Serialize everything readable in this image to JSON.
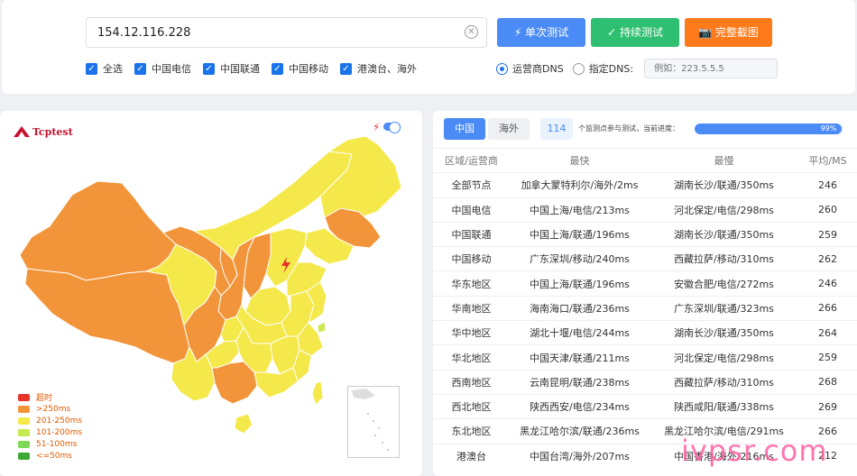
{
  "search": {
    "value": "154.12.116.228"
  },
  "buttons": {
    "single": "单次测试",
    "continuous": "持续测试",
    "screenshot": "完整截图"
  },
  "filters": [
    {
      "label": "全选",
      "checked": true
    },
    {
      "label": "中国电信",
      "checked": true
    },
    {
      "label": "中国联通",
      "checked": true
    },
    {
      "label": "中国移动",
      "checked": true
    },
    {
      "label": "港澳台、海外",
      "checked": true
    }
  ],
  "dns": {
    "isp_label": "运营商DNS",
    "custom_label": "指定DNS:",
    "placeholder": "例如：223.5.5.5",
    "selected": "isp"
  },
  "map": {
    "logo": "Tcptest",
    "legend": [
      {
        "label": "超时",
        "color": "#e5342a"
      },
      {
        "label": ">250ms",
        "color": "#f2953a"
      },
      {
        "label": "201-250ms",
        "color": "#f5e84a"
      },
      {
        "label": "101-200ms",
        "color": "#c7e94f"
      },
      {
        "label": "51-100ms",
        "color": "#7ed957"
      },
      {
        "label": "<=50ms",
        "color": "#3aa832"
      }
    ]
  },
  "results": {
    "tabs": [
      "中国",
      "海外"
    ],
    "active_tab": "中国",
    "count": "114",
    "count_label": "个监测点参与测试，当前进度：",
    "progress": 99,
    "progress_label": "99%",
    "headers": {
      "region": "区域/运营商",
      "fastest": "最快",
      "slowest": "最慢",
      "avg": "平均/MS"
    },
    "rows": [
      {
        "region": "全部节点",
        "fastest": "加拿大蒙特利尔/海外/2ms",
        "slowest": "湖南长沙/联通/350ms",
        "avg": "246"
      },
      {
        "region": "中国电信",
        "fastest": "中国上海/电信/213ms",
        "slowest": "河北保定/电信/298ms",
        "avg": "260"
      },
      {
        "region": "中国联通",
        "fastest": "中国上海/联通/196ms",
        "slowest": "湖南长沙/联通/350ms",
        "avg": "259"
      },
      {
        "region": "中国移动",
        "fastest": "广东深圳/移动/240ms",
        "slowest": "西藏拉萨/移动/310ms",
        "avg": "262"
      },
      {
        "region": "华东地区",
        "fastest": "中国上海/联通/196ms",
        "slowest": "安徽合肥/电信/272ms",
        "avg": "246"
      },
      {
        "region": "华南地区",
        "fastest": "海南海口/联通/236ms",
        "slowest": "广东深圳/联通/323ms",
        "avg": "266"
      },
      {
        "region": "华中地区",
        "fastest": "湖北十堰/电信/244ms",
        "slowest": "湖南长沙/联通/350ms",
        "avg": "264"
      },
      {
        "region": "华北地区",
        "fastest": "中国天津/联通/211ms",
        "slowest": "河北保定/电信/298ms",
        "avg": "259"
      },
      {
        "region": "西南地区",
        "fastest": "云南昆明/联通/238ms",
        "slowest": "西藏拉萨/移动/310ms",
        "avg": "268"
      },
      {
        "region": "西北地区",
        "fastest": "陕西西安/电信/234ms",
        "slowest": "陕西咸阳/联通/338ms",
        "avg": "269"
      },
      {
        "region": "东北地区",
        "fastest": "黑龙江哈尔滨/联通/236ms",
        "slowest": "黑龙江哈尔滨/电信/291ms",
        "avg": "266"
      },
      {
        "region": "港澳台",
        "fastest": "中国台湾/海外/207ms",
        "slowest": "中国香港/海外/216ms",
        "avg": "212"
      }
    ]
  },
  "watermark": "ivpsr.com"
}
